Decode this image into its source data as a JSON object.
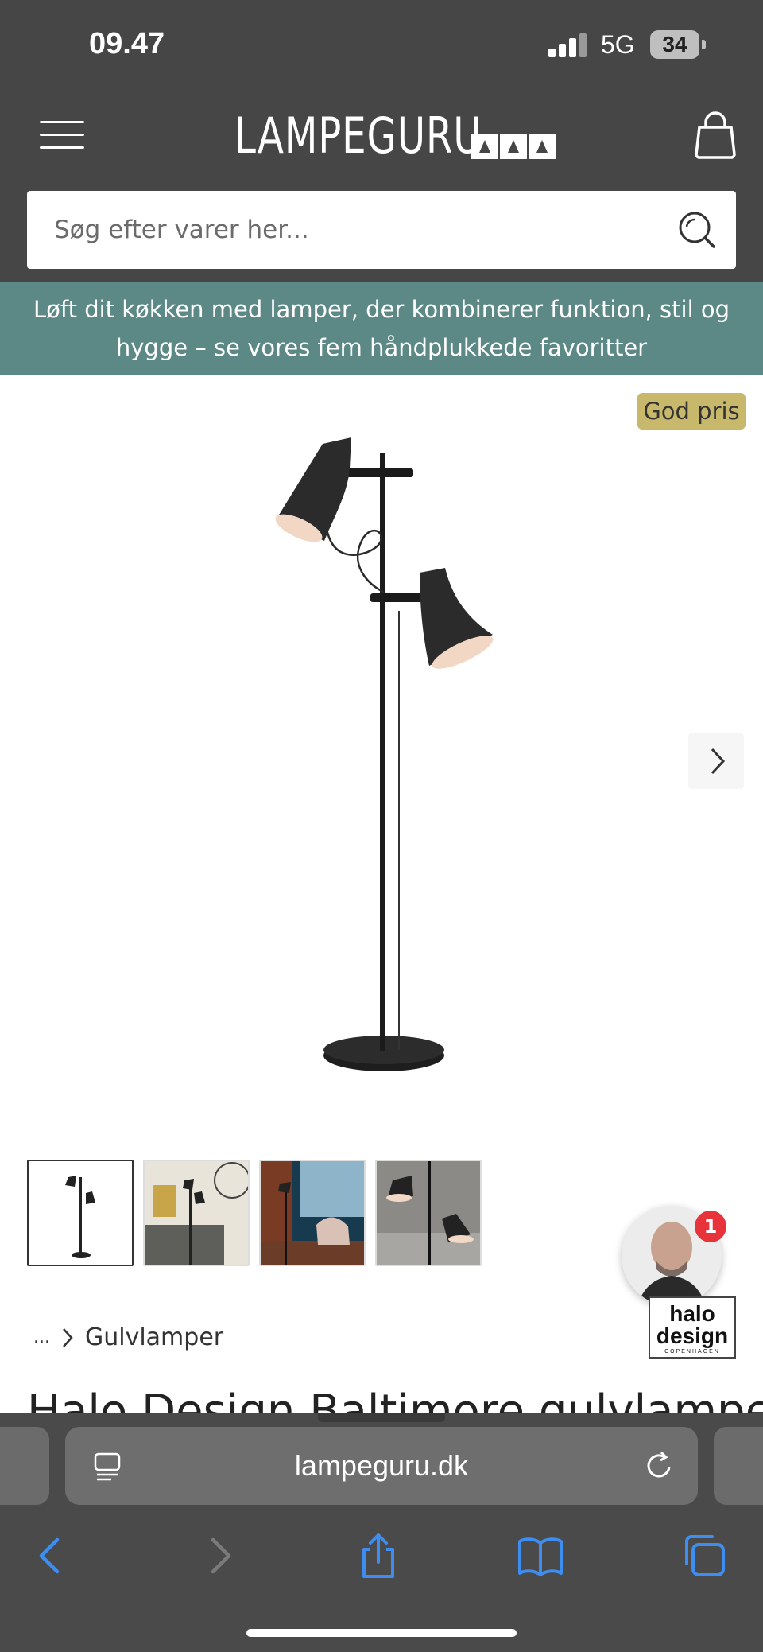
{
  "status_bar": {
    "time": "09.47",
    "network": "5G",
    "battery": "34"
  },
  "header": {
    "logo": "LAMPEGURU",
    "menu_icon": "hamburger-menu-icon",
    "cart_icon": "shopping-bag-icon"
  },
  "search": {
    "placeholder": "Søg efter varer her...",
    "icon": "search-icon"
  },
  "banner": {
    "line1": "Løft dit køkken med lamper, der kombinerer funktion, stil og",
    "line2": "hygge – se vores fem håndplukkede favoritter"
  },
  "product": {
    "badge": "God pris",
    "title": "Halo Design Baltimore gulvlampe",
    "thumbnail_count": 4
  },
  "chat": {
    "notification_count": "1",
    "brand_line1": "halo",
    "brand_line2": "design",
    "brand_line3": "COPENHAGEN"
  },
  "breadcrumb": {
    "ellipsis": "...",
    "current": "Gulvlamper"
  },
  "browser": {
    "url": "lampeguru.dk",
    "toolbar": [
      "back-icon",
      "forward-icon",
      "share-icon",
      "bookmarks-icon",
      "tabs-icon"
    ]
  },
  "colors": {
    "header_bg": "#464646",
    "banner_bg": "#5c8985",
    "badge_bg": "#c8b86b",
    "notification": "#e8333a",
    "browser_accent": "#3d8ef0"
  }
}
